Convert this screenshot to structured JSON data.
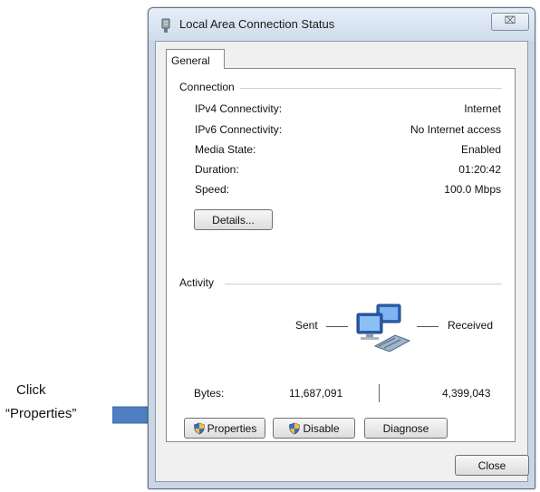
{
  "annotation": {
    "line1": "Click",
    "line2": "“Properties”"
  },
  "window": {
    "title": "Local Area Connection Status",
    "close_glyph": "⌧",
    "icon": "network-adapter-icon"
  },
  "tabs": [
    {
      "label": "General"
    }
  ],
  "connection": {
    "heading": "Connection",
    "rows": [
      {
        "label": "IPv4 Connectivity:",
        "value": "Internet"
      },
      {
        "label": "IPv6 Connectivity:",
        "value": "No Internet access"
      },
      {
        "label": "Media State:",
        "value": "Enabled"
      },
      {
        "label": "Duration:",
        "value": "01:20:42"
      },
      {
        "label": "Speed:",
        "value": "100.0 Mbps"
      }
    ],
    "details_label": "Details..."
  },
  "activity": {
    "heading": "Activity",
    "sent_label": "Sent",
    "received_label": "Received",
    "bytes_label": "Bytes:",
    "bytes_sent": "11,687,091",
    "bytes_received": "4,399,043",
    "icon": "network-computers-icon"
  },
  "buttons": {
    "properties": "Properties",
    "disable": "Disable",
    "diagnose": "Diagnose",
    "close": "Close"
  },
  "colors": {
    "arrow": "#4f7fc2",
    "shield_blue": "#3a6fc4",
    "shield_yellow": "#f2c12e"
  }
}
